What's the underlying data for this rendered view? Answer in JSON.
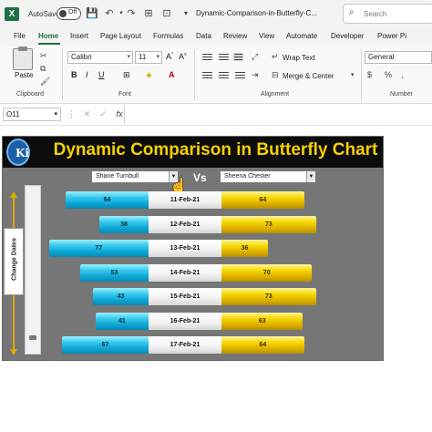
{
  "window": {
    "autosave_label": "AutoSave",
    "autosave_state": "Off",
    "doc_title": "Dynamic-Comparison-in-Butterfly-C...",
    "search_placeholder": "Search",
    "app_icon": "excel-icon"
  },
  "ribbon_tabs": [
    "File",
    "Home",
    "Insert",
    "Page Layout",
    "Formulas",
    "Data",
    "Review",
    "View",
    "Automate",
    "Developer",
    "Power Pi"
  ],
  "active_tab": "Home",
  "ribbon": {
    "clipboard": {
      "label": "Clipboard",
      "paste_label": "Paste"
    },
    "font": {
      "label": "Font",
      "font_name": "Calibri",
      "font_size": "11",
      "bold": "B",
      "italic": "I",
      "underline": "U"
    },
    "alignment": {
      "label": "Alignment",
      "wrap_text": "Wrap Text",
      "merge_center": "Merge & Center"
    },
    "number": {
      "label": "Number",
      "format": "General"
    }
  },
  "formula_bar": {
    "name_box": "O11",
    "fx": "fx",
    "cancel": "✕",
    "enter": "✓"
  },
  "chart": {
    "title": "Dynamic Comparison in Butterfly Chart",
    "logo_text": "Ki",
    "left_select": "Shane Turnbull",
    "right_select": "Sheena Chester",
    "vs_label": "Vs",
    "change_dates_label": "Change Dates",
    "rows": [
      {
        "left": "64",
        "date": "11-Feb-21",
        "right": "64"
      },
      {
        "left": "38",
        "date": "12-Feb-21",
        "right": "73"
      },
      {
        "left": "77",
        "date": "13-Feb-21",
        "right": "36"
      },
      {
        "left": "53",
        "date": "14-Feb-21",
        "right": "70"
      },
      {
        "left": "43",
        "date": "15-Feb-21",
        "right": "73"
      },
      {
        "left": "41",
        "date": "16-Feb-21",
        "right": "63"
      },
      {
        "left": "67",
        "date": "17-Feb-21",
        "right": "64"
      }
    ],
    "colors": {
      "left_bar": "#22c3e8",
      "right_bar": "#f2d000",
      "title": "#f5d000",
      "header_bg": "#0c0c0c",
      "plot_bg": "#767676"
    }
  }
}
